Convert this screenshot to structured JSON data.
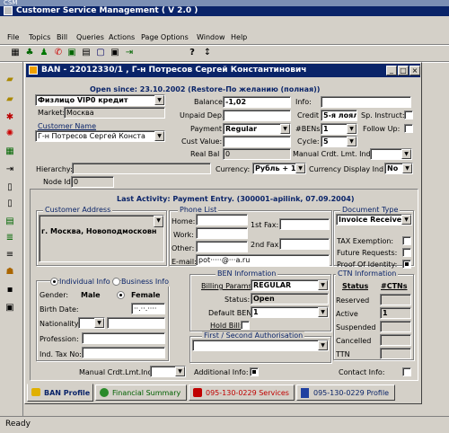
{
  "app": {
    "small_title": "CSM",
    "title": "Customer Service Management  ( V 2.0 )"
  },
  "menu": [
    "File",
    "Topics",
    "Bill",
    "Queries",
    "Actions",
    "Page Options",
    "Window",
    "Help"
  ],
  "ban_window": {
    "title": "BAN - 22012330/1 , Г-н Потресов Сергей Константинович"
  },
  "header": {
    "open_since": "Open since: 23.10.2002 (Restore-По желанию (полная))",
    "customer_type": "Физлицо  VIP0  кредит",
    "market_label": "Market:",
    "market_value": "Москва",
    "customer_name_label": "Customer Name",
    "customer_name_value": "Г-н Потресов Сергей Конста",
    "balance_label": "Balance:",
    "balance_value": "-1,02",
    "unpaid_label": "Unpaid Dep.:",
    "unpaid_value": "",
    "payment_label": "Payment",
    "payment_value": "Regular",
    "cust_value_label": "Cust Value:",
    "cust_value_value": "",
    "real_bal_label": "Real Bal",
    "real_bal_value": "0",
    "info_label": "Info:",
    "info_value": "",
    "credit_label": "Credit",
    "credit_value": "5-я лоял",
    "sp_instruct_label": "Sp. Instruct:",
    "bens_label": "#BENs:",
    "bens_value": "1",
    "follow_up_label": "Follow Up:",
    "cycle_label": "Cycle:",
    "cycle_value": "5",
    "manual_crdt_label": "Manual Crdt. Lmt. Ind:",
    "manual_crdt_value": "",
    "hierarchy_label": "Hierarchy:",
    "hierarchy_value": "",
    "currency_label": "Currency:",
    "currency_value": "Рубль + 1",
    "currency_display_label": "Currency Display Ind:",
    "currency_display_value": "No",
    "node_id_label": "Node Id:",
    "node_id_value": "0"
  },
  "last_activity": "Last Activity: Payment Entry. (300001-apilink, 07.09.2004)",
  "customer_address": {
    "label": "Customer Address",
    "value": "г. Москва, Новоподмосковн"
  },
  "phone_list": {
    "label": "Phone List",
    "home_label": "Home:",
    "home_value": "",
    "work_label": "Work:",
    "work_value": "",
    "other_label": "Other:",
    "other_value": "",
    "fax1_label": "1st Fax:",
    "fax1_value": "",
    "fax2_label": "2nd Fax:",
    "fax2_value": "",
    "email_label": "E-mail:",
    "email_value": "pot·····@···a.ru"
  },
  "document": {
    "label": "Document Type",
    "value": "Invoice Receiver",
    "tax_exemption": "TAX Exemption:",
    "future_requests": "Future Requests:",
    "proof_identity": "Proof Of Identity:"
  },
  "individual": {
    "individual_label": "Individual Info",
    "business_label": "Business Info",
    "gender_label": "Gender:",
    "male_label": "Male",
    "female_label": "Female",
    "birth_label": "Birth Date:",
    "birth_value": "··.··.····",
    "nationality_label": "Nationality:",
    "profession_label": "Profession:",
    "tax_label": "Ind. Tax No:",
    "manual_crdt_label": "Manual Crdt.Lmt.Ind:"
  },
  "ben": {
    "label": "BEN Information",
    "billing_label": "Billing Params:",
    "billing_value": "REGULAR",
    "status_label": "Status:",
    "status_value": "Open",
    "default_label": "Default BEN",
    "default_value": "1",
    "hold_label": "Hold Bill:",
    "auth_label": "First / Second  Authorisation",
    "additional_label": "Additional Info:"
  },
  "ctn": {
    "label": "CTN Information",
    "status_header": "Status",
    "ctns_header": "#CTNs",
    "rows": [
      {
        "status": "Reserved",
        "count": ""
      },
      {
        "status": "Active",
        "count": "1"
      },
      {
        "status": "Suspended",
        "count": ""
      },
      {
        "status": "Cancelled",
        "count": ""
      },
      {
        "status": "TTN",
        "count": ""
      }
    ],
    "contact_label": "Contact Info:"
  },
  "tabs": [
    {
      "label": "BAN Profile"
    },
    {
      "label": "Financial Summary"
    },
    {
      "label": "095-130-0229 Services"
    },
    {
      "label": "095-130-0229 Profile"
    }
  ],
  "status_bar": "Ready",
  "colors": {
    "title_bar": "#0a2469",
    "accent_text": "#0a2469",
    "services_tab": "#c00000"
  }
}
